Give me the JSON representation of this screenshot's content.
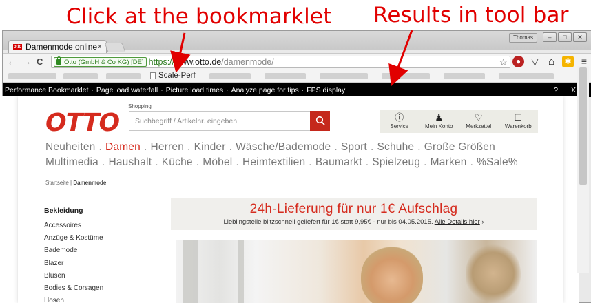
{
  "annotations": {
    "left": "Click at the bookmarklet",
    "right": "Results in tool bar"
  },
  "window": {
    "user": "Thomas",
    "controls": [
      "–",
      "□",
      "✕"
    ]
  },
  "tab": {
    "title": "Damenmode online",
    "favicon_text": "otto",
    "close": "×"
  },
  "toolbar": {
    "back": "←",
    "forward": "→",
    "reload": "C",
    "ev_label": "Otto (GmbH & Co KG) [DE]",
    "url_scheme": "https://",
    "url_host": "www.otto.de",
    "url_path": "/damenmode/",
    "star": "☆",
    "menu": "≡"
  },
  "bookmarks": {
    "item": "Scale-Perf",
    "more": "»"
  },
  "perfbar": {
    "items": [
      "Performance Bookmarklet",
      "Page load waterfall",
      "Picture load times",
      "Analyze page for tips",
      "FPS display"
    ],
    "help": "?",
    "close": "X"
  },
  "site": {
    "logo": "OTTO",
    "shopping_label": "Shopping",
    "search_placeholder": "Suchbegriff / Artikelnr. eingeben",
    "icons": [
      {
        "label": "Service",
        "glyph": "ⓘ",
        "icon": "info-icon"
      },
      {
        "label": "Mein Konto",
        "glyph": "♟",
        "icon": "user-icon"
      },
      {
        "label": "Merkzettel",
        "glyph": "♡",
        "icon": "heart-icon"
      },
      {
        "label": "Warenkorb",
        "glyph": "☐",
        "icon": "cart-icon"
      }
    ],
    "nav_row1": [
      "Neuheiten",
      "Damen",
      "Herren",
      "Kinder",
      "Wäsche/Bademode",
      "Sport",
      "Schuhe",
      "Große Größen"
    ],
    "nav_row2": [
      "Multimedia",
      "Haushalt",
      "Küche",
      "Möbel",
      "Heimtextilien",
      "Baumarkt",
      "Spielzeug",
      "Marken",
      "%Sale%"
    ],
    "nav_active": "Damen",
    "breadcrumb": {
      "home": "Startseite",
      "sep": "|",
      "current": "Damenmode"
    },
    "sidebar": {
      "heading": "Bekleidung",
      "links": [
        "Accessoires",
        "Anzüge & Kostüme",
        "Bademode",
        "Blazer",
        "Blusen",
        "Bodies & Corsagen",
        "Hosen"
      ]
    },
    "banner": {
      "headline": "24h-Lieferung für nur 1€ Aufschlag",
      "subtext": "Lieblingsteile blitzschnell geliefert für 1€ statt 9,95€ - nur bis 04.05.2015.",
      "link": "Alle Details hier",
      "chevron": "›"
    }
  },
  "colors": {
    "annotation": "#e10000",
    "otto_red": "#d52b1e",
    "perfbar_bg": "#000000"
  }
}
